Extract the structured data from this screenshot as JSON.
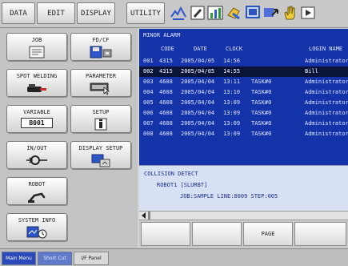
{
  "menu_tabs": [
    "DATA",
    "EDIT",
    "DISPLAY",
    "UTILITY"
  ],
  "toolbar_icons": [
    "multi-window-icon",
    "edit-icon",
    "chart-icon",
    "tool-icon",
    "screen-icon",
    "jump-icon",
    "hand-icon",
    "more-icon"
  ],
  "main_menu": {
    "job": "JOB",
    "fd_cf": "FD/CF",
    "spot_welding": "SPOT WELDING",
    "parameter": "PARAMETER",
    "variable": "VARIABLE",
    "variable_value": "B001",
    "setup": "SETUP",
    "in_out": "IN/OUT",
    "display_setup": "DISPLAY SETUP",
    "robot": "ROBOT",
    "system_info": "SYSTEM INFO"
  },
  "alarm": {
    "title": "MINOR ALARM",
    "headers": {
      "code": "CODE",
      "date": "DATE",
      "clock": "CLOCK",
      "login": "LOGIN NAME"
    },
    "rows": [
      {
        "no": "001",
        "code": "4315",
        "date": "2005/04/05",
        "clock": "14:56",
        "task": "",
        "login": "Administrator",
        "selected": false
      },
      {
        "no": "002",
        "code": "4315",
        "date": "2005/04/05",
        "clock": "14:55",
        "task": "",
        "login": "Bill",
        "selected": true
      },
      {
        "no": "003",
        "code": "4608",
        "date": "2005/04/04",
        "clock": "13:11",
        "task": "TASK#0",
        "login": "Administrator",
        "selected": false
      },
      {
        "no": "004",
        "code": "4608",
        "date": "2005/04/04",
        "clock": "13:10",
        "task": "TASK#0",
        "login": "Administrator",
        "selected": false
      },
      {
        "no": "005",
        "code": "4608",
        "date": "2005/04/04",
        "clock": "13:09",
        "task": "TASK#0",
        "login": "Administrator",
        "selected": false
      },
      {
        "no": "006",
        "code": "4608",
        "date": "2005/04/04",
        "clock": "13:09",
        "task": "TASK#0",
        "login": "Administrator",
        "selected": false
      },
      {
        "no": "007",
        "code": "4608",
        "date": "2005/04/04",
        "clock": "13:09",
        "task": "TASK#0",
        "login": "Administrator",
        "selected": false
      },
      {
        "no": "008",
        "code": "4608",
        "date": "2005/04/04",
        "clock": "13:09",
        "task": "TASK#0",
        "login": "Administrator",
        "selected": false
      }
    ]
  },
  "detail": {
    "line1": "COLLISION DETECT",
    "line2": "ROBOT1   [SLURBT]",
    "line3": "JOB:SAMPLE   LINE:0009 STEP:005"
  },
  "function_keys": [
    "",
    "",
    "PAGE",
    ""
  ],
  "bottom_tabs": [
    "Main Menu",
    "Short Cut",
    "I/F Panel"
  ],
  "colors": {
    "alarm_background": "#1533a8",
    "alarm_text": "#dfe6ff",
    "selected_row": "#0a1338",
    "detail_background": "#d8e1f4",
    "detail_text": "#1a2e8a",
    "active_bottom_tab": "#2b49b8"
  }
}
